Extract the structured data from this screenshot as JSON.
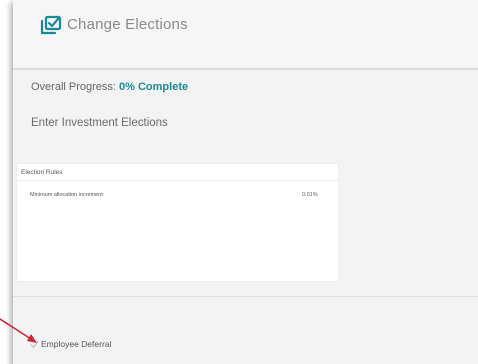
{
  "header": {
    "title": "Change Elections",
    "icon": "checkbox-stack-icon",
    "icon_color": "#1a8a9a"
  },
  "progress": {
    "label": "Overall Progress: ",
    "value": "0% Complete",
    "percent": 0,
    "accent_color": "#1a8a9a"
  },
  "section": {
    "title": "Enter Investment Elections"
  },
  "election_rules": {
    "title": "Election Rules",
    "rows": [
      {
        "label": "Minimum allocation increment:",
        "value": "0.01%"
      }
    ]
  },
  "deferral": {
    "label": "Employee Deferral",
    "icon": "check-icon"
  },
  "annotation": {
    "icon": "red-arrow-icon",
    "color": "#c8283a"
  }
}
